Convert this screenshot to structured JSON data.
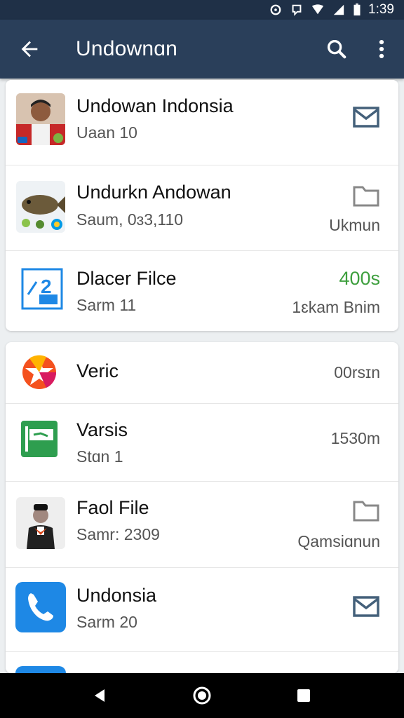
{
  "status_bar": {
    "time": "1:39",
    "icons": [
      "sync-icon",
      "notification-icon",
      "wifi-icon",
      "signal-icon",
      "battery-icon"
    ]
  },
  "app_bar": {
    "title": "Undownɑn",
    "back_icon": "arrow-left-icon",
    "search_icon": "search-icon",
    "menu_icon": "more-vert-icon"
  },
  "colors": {
    "app_bar": "#2a3f5a",
    "status_bar": "#1f3047",
    "accent_green": "#3e9f3e",
    "icon_slate": "#44607a"
  },
  "list1": [
    {
      "name": "Undowan Indonsia",
      "sub": "Uaan  10",
      "right_text": "",
      "right_icon": "mail-icon"
    },
    {
      "name": "Undurkn Andowan",
      "sub": "Saum, 0ɜ3,110",
      "right_text": "Ukmun",
      "right_icon": "folder-icon"
    },
    {
      "name": "Dlacer Filce",
      "sub": "Sarm 11",
      "right_top": "400s",
      "right_text": "1ɛkam Bnim",
      "right_icon": ""
    }
  ],
  "list2": [
    {
      "name": "Veric",
      "sub": "",
      "right_text": "00rsɪn",
      "right_icon": ""
    },
    {
      "name": "Varsis",
      "sub": "Stɑn 1",
      "right_text": "1530m",
      "right_icon": ""
    },
    {
      "name": "Faol File",
      "sub": "Samr: 2309",
      "right_text": "Qamsiɑnun",
      "right_icon": "folder-icon"
    },
    {
      "name": "Undonsia",
      "sub": "Sarm 20",
      "right_text": "",
      "right_icon": "mail-icon"
    }
  ],
  "nav": {
    "back": "triangle-back-icon",
    "home": "circle-home-icon",
    "recents": "square-recents-icon"
  }
}
